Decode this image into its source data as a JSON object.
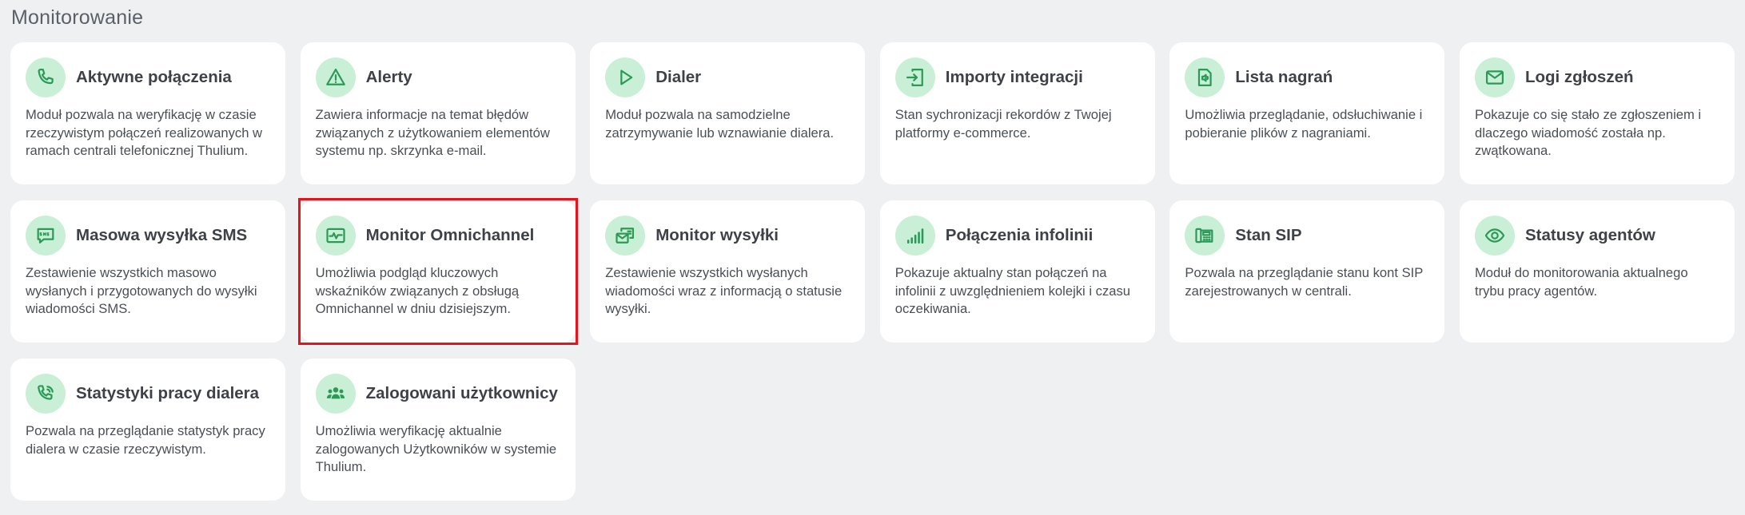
{
  "section": {
    "title": "Monitorowanie"
  },
  "cards": [
    {
      "title": "Aktywne połączenia",
      "description": "Moduł pozwala na weryfikację w czasie rzeczywistym połączeń realizowanych w ramach centrali telefonicznej Thulium.",
      "icon": "phone-icon"
    },
    {
      "title": "Alerty",
      "description": "Zawiera informacje na temat błędów związanych z użytkowaniem elementów systemu np. skrzynka e-mail.",
      "icon": "alert-triangle-icon"
    },
    {
      "title": "Dialer",
      "description": "Moduł pozwala na samodzielne zatrzymywanie lub wznawianie dialera.",
      "icon": "play-icon"
    },
    {
      "title": "Importy integracji",
      "description": "Stan sychronizacji rekordów z Twojej platformy e-commerce.",
      "icon": "import-icon"
    },
    {
      "title": "Lista nagrań",
      "description": "Umożliwia przeglądanie, odsłuchiwanie i pobieranie plików z nagraniami.",
      "icon": "audio-file-icon"
    },
    {
      "title": "Logi zgłoszeń",
      "description": "Pokazuje co się stało ze zgłoszeniem i dlaczego wiadomość została np. zwątkowana.",
      "icon": "envelope-icon"
    },
    {
      "title": "Masowa wysyłka SMS",
      "description": "Zestawienie wszystkich masowo wysłanych i przygotowanych do wysyłki wiadomości SMS.",
      "icon": "sms-icon"
    },
    {
      "title": "Monitor Omnichannel",
      "description": "Umożliwia podgląd kluczowych wskaźników związanych z obsługą Omnichannel w dniu dzisiejszym.",
      "icon": "activity-monitor-icon"
    },
    {
      "title": "Monitor wysyłki",
      "description": "Zestawienie wszystkich wysłanych wiadomości wraz z informacją o statusie wysyłki.",
      "icon": "mail-send-icon"
    },
    {
      "title": "Połączenia infolinii",
      "description": "Pokazuje aktualny stan połączeń na infolinii z uwzględnieniem kolejki i czasu oczekiwania.",
      "icon": "signal-bars-icon"
    },
    {
      "title": "Stan SIP",
      "description": "Pozwala na przeglądanie stanu kont SIP zarejestrowanych w centrali.",
      "icon": "sip-phone-icon"
    },
    {
      "title": "Statusy agentów",
      "description": "Moduł do monitorowania aktualnego trybu pracy agentów.",
      "icon": "eye-icon"
    },
    {
      "title": "Statystyki pracy dialera",
      "description": "Pozwala na przeglądanie statystyk pracy dialera w czasie rzeczywistym.",
      "icon": "phone-stats-icon"
    },
    {
      "title": "Zalogowani użytkownicy",
      "description": "Umożliwia weryfikację aktualnie zalogowanych Użytkowników w systemie Thulium.",
      "icon": "users-group-icon"
    }
  ],
  "colors": {
    "background": "#eff0f1",
    "card": "#ffffff",
    "icon_circle": "#c9f0d6",
    "icon_stroke": "#2c9a57",
    "highlight_border": "#e3141b"
  }
}
